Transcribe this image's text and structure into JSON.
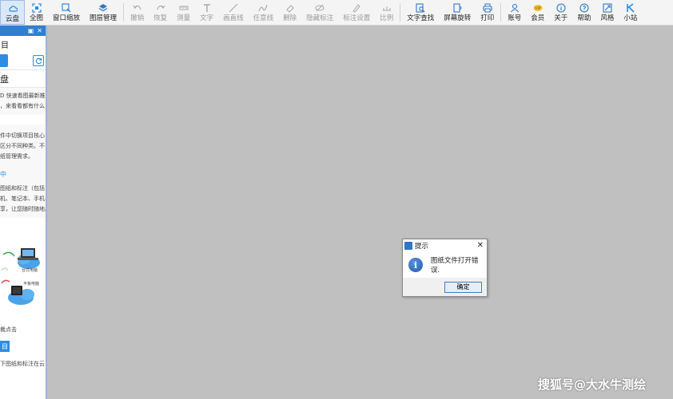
{
  "toolbar": {
    "items": [
      {
        "label": "云盘",
        "icon": "cloud-icon",
        "state": "active"
      },
      {
        "label": "全图",
        "icon": "fit-view-icon",
        "state": "enabled"
      },
      {
        "label": "窗口缩放",
        "icon": "zoom-window-icon",
        "state": "enabled"
      },
      {
        "label": "图层管理",
        "icon": "layers-icon",
        "state": "enabled"
      },
      {
        "label": "撤销",
        "icon": "undo-icon",
        "state": "disabled"
      },
      {
        "label": "恢复",
        "icon": "redo-icon",
        "state": "disabled"
      },
      {
        "label": "测量",
        "icon": "measure-icon",
        "state": "disabled"
      },
      {
        "label": "文字",
        "icon": "text-icon",
        "state": "disabled"
      },
      {
        "label": "画直线",
        "icon": "line-icon",
        "state": "disabled"
      },
      {
        "label": "任意线",
        "icon": "freehand-icon",
        "state": "disabled"
      },
      {
        "label": "删除",
        "icon": "eraser-icon",
        "state": "disabled"
      },
      {
        "label": "隐藏标注",
        "icon": "hide-annotation-icon",
        "state": "disabled"
      },
      {
        "label": "标注设置",
        "icon": "annotation-settings-icon",
        "state": "disabled"
      },
      {
        "label": "比例",
        "icon": "scale-icon",
        "state": "disabled"
      },
      {
        "label": "文字查找",
        "icon": "find-text-icon",
        "state": "enabled"
      },
      {
        "label": "屏幕旋转",
        "icon": "rotate-screen-icon",
        "state": "enabled"
      },
      {
        "label": "打印",
        "icon": "printer-icon",
        "state": "enabled"
      },
      {
        "label": "账号",
        "icon": "user-icon",
        "state": "enabled"
      },
      {
        "label": "会员",
        "icon": "vip-icon",
        "state": "enabled"
      },
      {
        "label": "关于",
        "icon": "info-icon",
        "state": "enabled"
      },
      {
        "label": "帮助",
        "icon": "help-icon",
        "state": "enabled"
      },
      {
        "label": "风格",
        "icon": "style-icon",
        "state": "enabled"
      },
      {
        "label": "小站",
        "icon": "station-icon",
        "state": "enabled"
      }
    ]
  },
  "sidebar": {
    "title": "目",
    "card_title": "盘",
    "text_block_1": [
      "D 快速看图最新推",
      "，来看看都有什么"
    ],
    "text_block_2": [
      "件中切换项目核心",
      "区分不同种类。不",
      "纸管理需求。"
    ],
    "blue_label": "中",
    "text_block_3": [
      "图纸和标注（包括",
      "机、笔记本、手机、",
      "享，让您随时随地。"
    ],
    "device_label_1": "台式电脑",
    "device_label_2": "平板电脑",
    "bottom_text_1": "裁点击",
    "bottom_button": "目",
    "bottom_text_2": "下图纸和标注在云"
  },
  "dialog": {
    "title": "提示",
    "message": "图纸文件打开错误.",
    "ok_label": "确定",
    "close_glyph": "✕",
    "icon_glyph": "i"
  },
  "watermark": "搜狐号@大水牛测绘",
  "colors": {
    "accent": "#2e8de0",
    "canvas": "#c0c0c0",
    "toolbar": "#f4f4f4"
  }
}
